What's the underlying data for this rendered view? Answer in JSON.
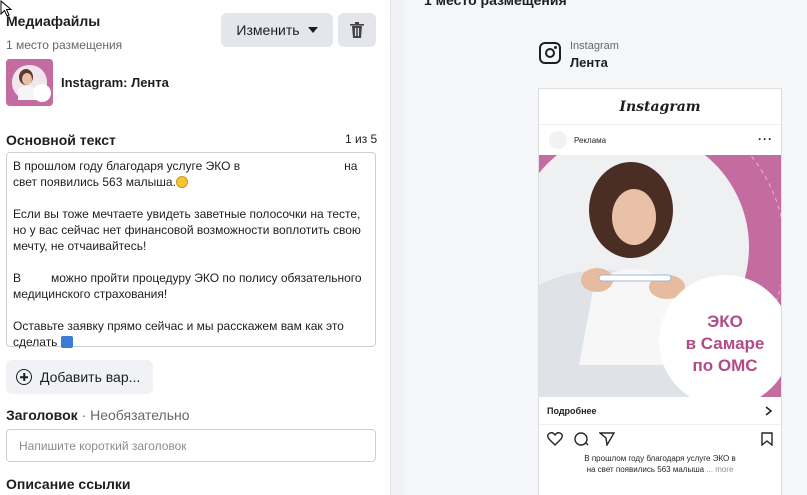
{
  "left": {
    "title": "Медиафайлы",
    "subtitle": "1 место размещения",
    "edit_label": "Изменить",
    "media_name": "Instagram: Лента",
    "primary_text_label": "Основной текст",
    "counter": "1 из 5",
    "primary_text": {
      "p1a": "В прошлом году благодаря услуге ЭКО в",
      "p1b": "на свет появились 563 малыша.",
      "p2": "Если вы тоже мечтаете увидеть заветные полосочки на тесте, но у вас сейчас нет финансовой возможности воплотить свою мечту, не отчаивайтесь!",
      "p3a": "В",
      "p3b": "можно пройти процедуру ЭКО по полису обязательного медицинского страхования!",
      "p4": "Оставьте заявку прямо сейчас и мы расскажем вам как это сделать"
    },
    "add_variant_label": "Добавить вар...",
    "headline_label": "Заголовок",
    "headline_optional": " · Необязательно",
    "headline_placeholder": "Напишите короткий заголовок",
    "link_desc_label": "Описание ссылки"
  },
  "right": {
    "header": "1 место размещения",
    "platform": "Instagram",
    "placement": "Лента",
    "ig_wordmark": "Instagram",
    "sponsored": "Реклама",
    "dots": "···",
    "image_text": [
      "ЭКО",
      "в Самаре",
      "по ОМС"
    ],
    "learn_more": "Подробнее",
    "caption_line1": "В прошлом году благодаря услуге ЭКО в",
    "caption_line2": "на свет появились 563 малыша",
    "caption_more": "... more"
  },
  "colors": {
    "brand_pink": "#c46ba0",
    "pink_text": "#b34b8a",
    "divider": "#f0f2f5"
  }
}
